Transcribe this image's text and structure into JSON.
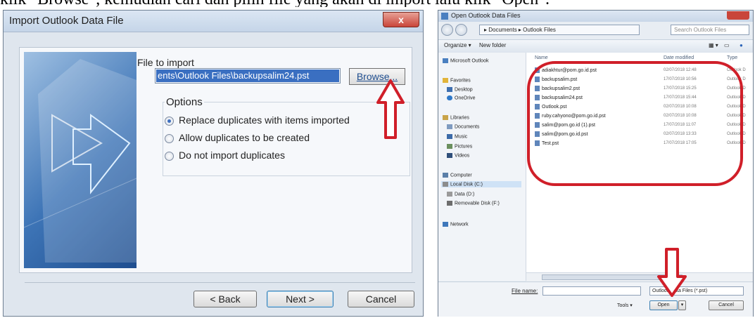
{
  "caption": "klik \"Browse\", kemudian cari dan pilih file yang akan di import lalu klik \"Open\".",
  "import_dialog": {
    "title": "Import Outlook Data File",
    "close_label": "x",
    "file_to_import_label": "File to import",
    "file_path": "ents\\Outlook Files\\backupsalim24.pst",
    "browse_label": "Browse...",
    "options_label": "Options",
    "options": [
      {
        "label": "Replace duplicates with items imported",
        "selected": true
      },
      {
        "label": "Allow duplicates to be created",
        "selected": false
      },
      {
        "label": "Do not import duplicates",
        "selected": false
      }
    ],
    "back_label": "< Back",
    "next_label": "Next >",
    "cancel_label": "Cancel"
  },
  "file_dialog": {
    "title": "Open Outlook Data Files",
    "breadcrumb": "▸ Documents ▸ Outlook Files",
    "search_placeholder": "Search Outlook Files",
    "organize_label": "Organize ▾",
    "new_folder_label": "New folder",
    "nav": {
      "microsoft_outlook": "Microsoft Outlook",
      "favorites": "Favorites",
      "favorites_items": [
        "Desktop",
        "OneDrive"
      ],
      "libraries": "Libraries",
      "libraries_items": [
        "Documents",
        "Music",
        "Pictures",
        "Videos"
      ],
      "computer": "Computer",
      "computer_items": [
        "Local Disk (C:)",
        "Data (D:)",
        "Removable Disk (F:)"
      ],
      "network": "Network"
    },
    "columns": [
      "Name",
      "Date modified",
      "Type"
    ],
    "files": [
      {
        "name": "adiakhtur@pom.go.id.pst",
        "date": "02/07/2018 12:48",
        "type": "Outlook D"
      },
      {
        "name": "backupsalim.pst",
        "date": "17/07/2018 10:56",
        "type": "Outlook D"
      },
      {
        "name": "backupsalim2.pst",
        "date": "17/07/2018 15:25",
        "type": "Outlook D"
      },
      {
        "name": "backupsalim24.pst",
        "date": "17/07/2018 15:44",
        "type": "Outlook D"
      },
      {
        "name": "Outlook.pst",
        "date": "02/07/2018 10:08",
        "type": "Outlook D"
      },
      {
        "name": "ruby.cahyono@pom.go.id.pst",
        "date": "02/07/2018 10:08",
        "type": "Outlook D"
      },
      {
        "name": "salim@pom.go.id (1).pst",
        "date": "17/07/2018 11:07",
        "type": "Outlook D"
      },
      {
        "name": "salim@pom.go.id.pst",
        "date": "02/07/2018 13:33",
        "type": "Outlook D"
      },
      {
        "name": "Test.pst",
        "date": "17/07/2018 17:05",
        "type": "Outlook D"
      }
    ],
    "file_name_label": "File name:",
    "file_type": "Outlook Data Files (*.pst)",
    "tools_label": "Tools",
    "open_label": "Open",
    "cancel_label": "Cancel"
  },
  "colors": {
    "accent_red": "#d01f29",
    "selection_blue": "#3a6fc1"
  }
}
